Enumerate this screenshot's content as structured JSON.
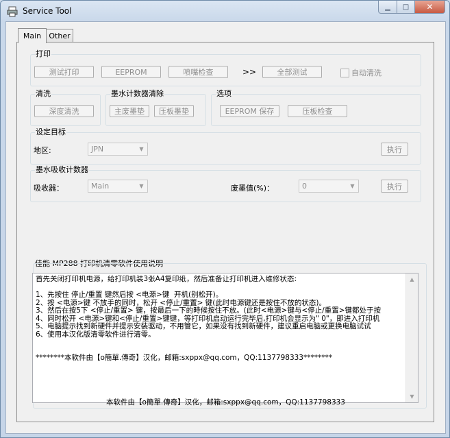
{
  "window": {
    "title": "Service Tool"
  },
  "tabs": {
    "main": "Main",
    "other": "Other"
  },
  "print_group": {
    "label": "打印",
    "test_print": "测试打印",
    "eeprom": "EEPROM",
    "nozzle_check": "喷嘴检查",
    "arrows": ">>",
    "test_all": "全部测试",
    "auto_clean": "自动清洗"
  },
  "clean_group": {
    "label": "清洗",
    "deep_clean": "深度清洗"
  },
  "ink_counter_group": {
    "label": "墨水计数器清除",
    "main_pad": "主废墨垫",
    "platen_pad": "压板墨垫"
  },
  "options_group": {
    "label": "选项",
    "eeprom_save": "EEPROM 保存",
    "platen_check": "压板检查"
  },
  "target_group": {
    "label": "设定目标",
    "region_label": "地区:",
    "region_value": "JPN",
    "execute": "执行"
  },
  "absorber_group": {
    "label": "墨水吸收计数器",
    "absorber_label": "吸收器：",
    "absorber_value": "Main",
    "waste_label": "废墨值(%)：",
    "waste_value": "0",
    "execute": "执行"
  },
  "instructions": {
    "title": "佳能 MP288 打印机清零软件使用说明",
    "text": "首先关闭打印机电源，给打印机装3张A4复印纸，然后准备让打印机进入维修状态:\n\n1、先按住 停止/重置 键然后按 <电源>键  开机(别松开)。\n2、按 <电源>键 不放手的同时，松开 <停止/重置> 键(此时电源键还是按住不放的状态)。\n3、然后在按5下 <停止/重置> 键，按最后一下的時候按住不放。(此时<电源>键与<停止/重置>键都处于按\n4、同时松开 <电源>键和<停止/重置>键键，等打印机启动运行完毕后,打印机会显示为\" 0\"，即进入打印机\n5、电脑提示找到新硬件并提示安装驱动，不用管它，如果没有找到新硬件，建议重启电脑或更换电脑试试\n6、使用本汉化版清零软件进行清零。\n\n\n********本软件由【o簡單.傳奇】汉化，邮箱:sxppx@qq.com，QQ:1137798333********"
  },
  "footer": "本软件由【o簡單.傳奇】汉化，邮箱:sxppx@qq.com，QQ:1137798333",
  "colors": {
    "titlebar": "#dbe6f3",
    "close": "#c75a43",
    "disabled_text": "#8d8d8d"
  }
}
